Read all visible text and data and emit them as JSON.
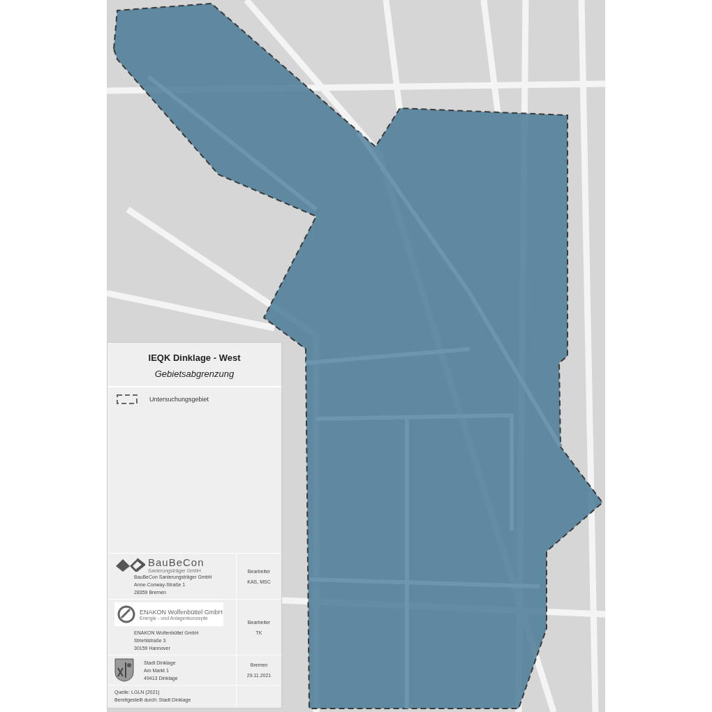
{
  "legend": {
    "title": "IEQK Dinklage - West",
    "subtitle": "Gebietsabgrenzung",
    "items": [
      {
        "kind": "dashed-boundary",
        "label": "Untersuchungsgebiet"
      }
    ],
    "contacts": [
      {
        "kind": "baubecon",
        "logo_name": "BauBeCon",
        "logo_sub": "Sanierungsträger GmbH",
        "address": [
          "BauBeCon Sanierungsträger GmbH",
          "Anne-Conway-Straße 1",
          "28359 Bremen"
        ],
        "side": [
          "Bearbeiter",
          "KAS, MSC"
        ]
      },
      {
        "kind": "enakon",
        "logo_name": "ENAKON Wolfenbüttel GmbH",
        "logo_sub": "Energie - und Anlagenkonzepte",
        "address": [
          "ENAKON Wolfenbüttel GmbH",
          "Striehlstraße 3",
          "30159 Hannover"
        ],
        "side": [
          "Bearbeiter",
          "TK"
        ]
      },
      {
        "kind": "coat-of-arms",
        "address": [
          "Stadt Dinklage",
          "Am Markt 1",
          "49413 Dinklage"
        ],
        "side": [
          "Bremen",
          "29.11.2021"
        ]
      }
    ],
    "source": [
      "Quelle: LGLN (2021)",
      "Bereitgestellt durch: Stadt Dinklage"
    ]
  }
}
